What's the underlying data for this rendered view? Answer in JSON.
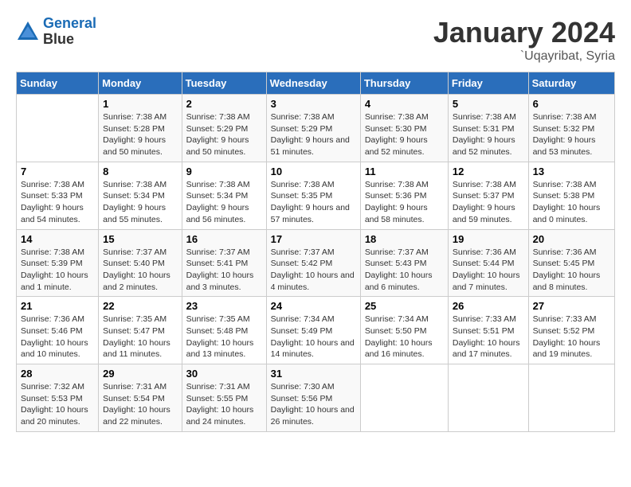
{
  "header": {
    "logo_line1": "General",
    "logo_line2": "Blue",
    "month": "January 2024",
    "location": "`Uqayribat, Syria"
  },
  "weekdays": [
    "Sunday",
    "Monday",
    "Tuesday",
    "Wednesday",
    "Thursday",
    "Friday",
    "Saturday"
  ],
  "weeks": [
    [
      {
        "day": "",
        "sunrise": "",
        "sunset": "",
        "daylight": ""
      },
      {
        "day": "1",
        "sunrise": "Sunrise: 7:38 AM",
        "sunset": "Sunset: 5:28 PM",
        "daylight": "Daylight: 9 hours and 50 minutes."
      },
      {
        "day": "2",
        "sunrise": "Sunrise: 7:38 AM",
        "sunset": "Sunset: 5:29 PM",
        "daylight": "Daylight: 9 hours and 50 minutes."
      },
      {
        "day": "3",
        "sunrise": "Sunrise: 7:38 AM",
        "sunset": "Sunset: 5:29 PM",
        "daylight": "Daylight: 9 hours and 51 minutes."
      },
      {
        "day": "4",
        "sunrise": "Sunrise: 7:38 AM",
        "sunset": "Sunset: 5:30 PM",
        "daylight": "Daylight: 9 hours and 52 minutes."
      },
      {
        "day": "5",
        "sunrise": "Sunrise: 7:38 AM",
        "sunset": "Sunset: 5:31 PM",
        "daylight": "Daylight: 9 hours and 52 minutes."
      },
      {
        "day": "6",
        "sunrise": "Sunrise: 7:38 AM",
        "sunset": "Sunset: 5:32 PM",
        "daylight": "Daylight: 9 hours and 53 minutes."
      }
    ],
    [
      {
        "day": "7",
        "sunrise": "Sunrise: 7:38 AM",
        "sunset": "Sunset: 5:33 PM",
        "daylight": "Daylight: 9 hours and 54 minutes."
      },
      {
        "day": "8",
        "sunrise": "Sunrise: 7:38 AM",
        "sunset": "Sunset: 5:34 PM",
        "daylight": "Daylight: 9 hours and 55 minutes."
      },
      {
        "day": "9",
        "sunrise": "Sunrise: 7:38 AM",
        "sunset": "Sunset: 5:34 PM",
        "daylight": "Daylight: 9 hours and 56 minutes."
      },
      {
        "day": "10",
        "sunrise": "Sunrise: 7:38 AM",
        "sunset": "Sunset: 5:35 PM",
        "daylight": "Daylight: 9 hours and 57 minutes."
      },
      {
        "day": "11",
        "sunrise": "Sunrise: 7:38 AM",
        "sunset": "Sunset: 5:36 PM",
        "daylight": "Daylight: 9 hours and 58 minutes."
      },
      {
        "day": "12",
        "sunrise": "Sunrise: 7:38 AM",
        "sunset": "Sunset: 5:37 PM",
        "daylight": "Daylight: 9 hours and 59 minutes."
      },
      {
        "day": "13",
        "sunrise": "Sunrise: 7:38 AM",
        "sunset": "Sunset: 5:38 PM",
        "daylight": "Daylight: 10 hours and 0 minutes."
      }
    ],
    [
      {
        "day": "14",
        "sunrise": "Sunrise: 7:38 AM",
        "sunset": "Sunset: 5:39 PM",
        "daylight": "Daylight: 10 hours and 1 minute."
      },
      {
        "day": "15",
        "sunrise": "Sunrise: 7:37 AM",
        "sunset": "Sunset: 5:40 PM",
        "daylight": "Daylight: 10 hours and 2 minutes."
      },
      {
        "day": "16",
        "sunrise": "Sunrise: 7:37 AM",
        "sunset": "Sunset: 5:41 PM",
        "daylight": "Daylight: 10 hours and 3 minutes."
      },
      {
        "day": "17",
        "sunrise": "Sunrise: 7:37 AM",
        "sunset": "Sunset: 5:42 PM",
        "daylight": "Daylight: 10 hours and 4 minutes."
      },
      {
        "day": "18",
        "sunrise": "Sunrise: 7:37 AM",
        "sunset": "Sunset: 5:43 PM",
        "daylight": "Daylight: 10 hours and 6 minutes."
      },
      {
        "day": "19",
        "sunrise": "Sunrise: 7:36 AM",
        "sunset": "Sunset: 5:44 PM",
        "daylight": "Daylight: 10 hours and 7 minutes."
      },
      {
        "day": "20",
        "sunrise": "Sunrise: 7:36 AM",
        "sunset": "Sunset: 5:45 PM",
        "daylight": "Daylight: 10 hours and 8 minutes."
      }
    ],
    [
      {
        "day": "21",
        "sunrise": "Sunrise: 7:36 AM",
        "sunset": "Sunset: 5:46 PM",
        "daylight": "Daylight: 10 hours and 10 minutes."
      },
      {
        "day": "22",
        "sunrise": "Sunrise: 7:35 AM",
        "sunset": "Sunset: 5:47 PM",
        "daylight": "Daylight: 10 hours and 11 minutes."
      },
      {
        "day": "23",
        "sunrise": "Sunrise: 7:35 AM",
        "sunset": "Sunset: 5:48 PM",
        "daylight": "Daylight: 10 hours and 13 minutes."
      },
      {
        "day": "24",
        "sunrise": "Sunrise: 7:34 AM",
        "sunset": "Sunset: 5:49 PM",
        "daylight": "Daylight: 10 hours and 14 minutes."
      },
      {
        "day": "25",
        "sunrise": "Sunrise: 7:34 AM",
        "sunset": "Sunset: 5:50 PM",
        "daylight": "Daylight: 10 hours and 16 minutes."
      },
      {
        "day": "26",
        "sunrise": "Sunrise: 7:33 AM",
        "sunset": "Sunset: 5:51 PM",
        "daylight": "Daylight: 10 hours and 17 minutes."
      },
      {
        "day": "27",
        "sunrise": "Sunrise: 7:33 AM",
        "sunset": "Sunset: 5:52 PM",
        "daylight": "Daylight: 10 hours and 19 minutes."
      }
    ],
    [
      {
        "day": "28",
        "sunrise": "Sunrise: 7:32 AM",
        "sunset": "Sunset: 5:53 PM",
        "daylight": "Daylight: 10 hours and 20 minutes."
      },
      {
        "day": "29",
        "sunrise": "Sunrise: 7:31 AM",
        "sunset": "Sunset: 5:54 PM",
        "daylight": "Daylight: 10 hours and 22 minutes."
      },
      {
        "day": "30",
        "sunrise": "Sunrise: 7:31 AM",
        "sunset": "Sunset: 5:55 PM",
        "daylight": "Daylight: 10 hours and 24 minutes."
      },
      {
        "day": "31",
        "sunrise": "Sunrise: 7:30 AM",
        "sunset": "Sunset: 5:56 PM",
        "daylight": "Daylight: 10 hours and 26 minutes."
      },
      {
        "day": "",
        "sunrise": "",
        "sunset": "",
        "daylight": ""
      },
      {
        "day": "",
        "sunrise": "",
        "sunset": "",
        "daylight": ""
      },
      {
        "day": "",
        "sunrise": "",
        "sunset": "",
        "daylight": ""
      }
    ]
  ]
}
